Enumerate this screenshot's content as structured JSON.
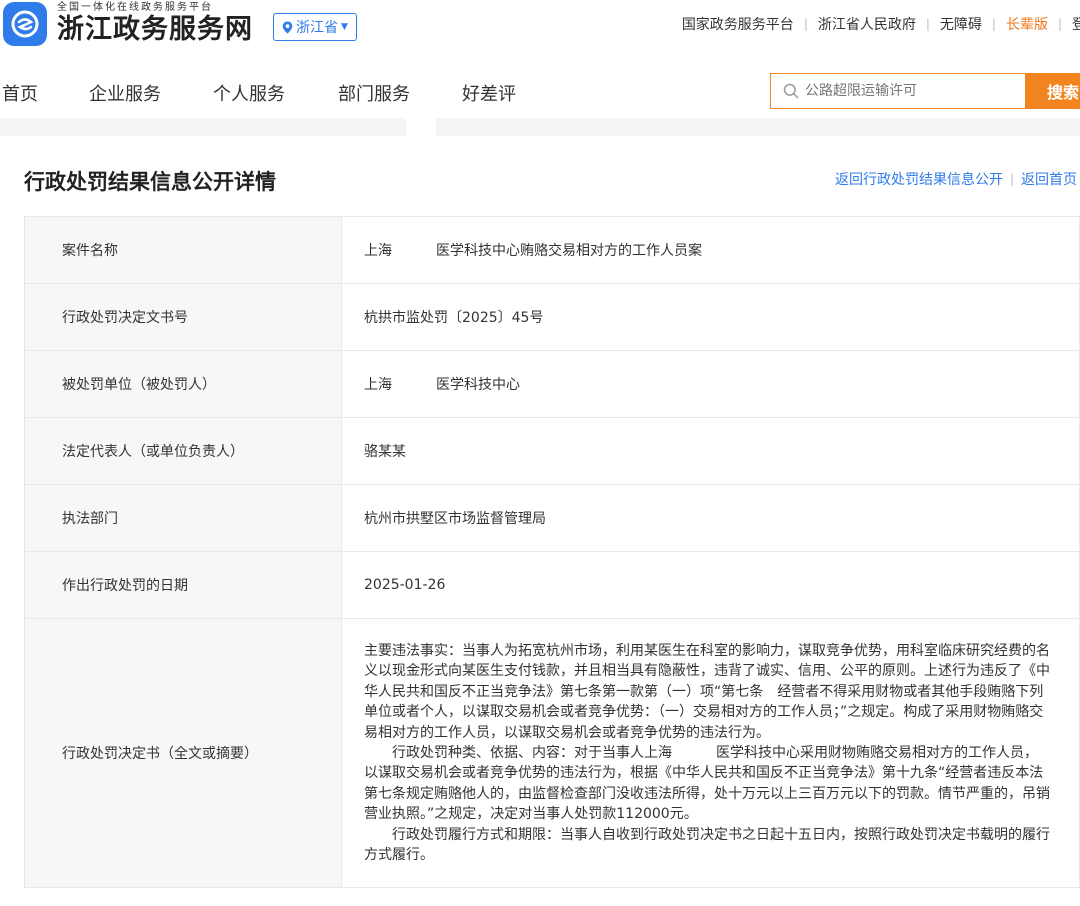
{
  "header": {
    "logo_subtitle": "全国一体化在线政务服务平台",
    "logo_title": "浙江政务服务网",
    "region": "浙江省",
    "links": [
      "国家政务服务平台",
      "浙江省人民政府",
      "无障碍",
      "长辈版",
      "登"
    ]
  },
  "nav": {
    "items": [
      "首页",
      "企业服务",
      "个人服务",
      "部门服务",
      "好差评"
    ]
  },
  "search": {
    "placeholder": "公路超限运输许可",
    "button": "搜索"
  },
  "page": {
    "title": "行政处罚结果信息公开详情",
    "back_list": "返回行政处罚结果信息公开",
    "back_home": "返回首页"
  },
  "details": {
    "rows": [
      {
        "label": "案件名称",
        "value_pre": "上海",
        "value_post": "医学科技中心贿赂交易相对方的工作人员案"
      },
      {
        "label": "行政处罚决定文书号",
        "value": "杭拱市监处罚〔2025〕45号"
      },
      {
        "label": "被处罚单位（被处罚人）",
        "value_pre": "上海",
        "value_post": "医学科技中心"
      },
      {
        "label": "法定代表人（或单位负责人）",
        "value": "骆某某"
      },
      {
        "label": "执法部门",
        "value": "杭州市拱墅区市场监督管理局"
      },
      {
        "label": "作出行政处罚的日期",
        "value": "2025-01-26"
      },
      {
        "label": "行政处罚决定书（全文或摘要）",
        "p1": "主要违法事实：当事人为拓宽杭州市场，利用某医生在科室的影响力，谋取竞争优势，用科室临床研究经费的名义以现金形式向某医生支付钱款，并且相当具有隐蔽性，违背了诚实、信用、公平的原则。上述行为违反了《中华人民共和国反不正当竞争法》第七条第一款第（一）项“第七条　经营者不得采用财物或者其他手段贿赂下列单位或者个人，以谋取交易机会或者竞争优势：（一）交易相对方的工作人员；”之规定。构成了采用财物贿赂交易相对方的工作人员，以谋取交易机会或者竞争优势的违法行为。",
        "p2_pre": "行政处罚种类、依据、内容：对于当事人上海",
        "p2_post": "医学科技中心采用财物贿赂交易相对方的工作人员，以谋取交易机会或者竞争优势的违法行为，根据《中华人民共和国反不正当竞争法》第十九条“经营者违反本法第七条规定贿赂他人的，由监督检查部门没收违法所得，处十万元以上三百万元以下的罚款。情节严重的，吊销营业执照。”之规定，决定对当事人处罚款112000元。",
        "p3": "行政处罚履行方式和期限：当事人自收到行政处罚决定书之日起十五日内，按照行政处罚决定书载明的履行方式履行。"
      }
    ]
  }
}
